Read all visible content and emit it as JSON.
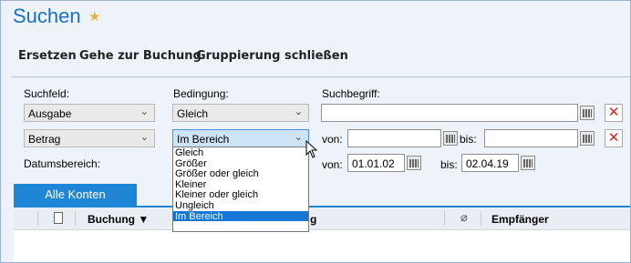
{
  "window": {
    "title": "Suchen"
  },
  "menu": {
    "items": [
      "Ersetzen",
      "Gehe zur Buchung",
      "Gruppierung schließen"
    ]
  },
  "labels": {
    "suchfeld": "Suchfeld:",
    "bedingung": "Bedingung:",
    "suchbegriff": "Suchbegriff:",
    "von": "von:",
    "bis": "bis:",
    "datumsbereich": "Datumsbereich:"
  },
  "row1": {
    "field": "Ausgabe",
    "condition": "Gleich",
    "term": ""
  },
  "row2": {
    "field": "Betrag",
    "condition": "Im Bereich",
    "from": "",
    "to": ""
  },
  "date": {
    "from": "01.01.02",
    "to": "02.04.19"
  },
  "tabs": {
    "active": "Alle Konten"
  },
  "grid": {
    "columns": [
      "Buchung",
      "g",
      "Empfänger"
    ],
    "sort_indicator": "▼"
  },
  "dropdown": {
    "options": [
      "Gleich",
      "Größer",
      "Größer oder gleich",
      "Kleiner",
      "Kleiner oder gleich",
      "Ungleich",
      "Im Bereich"
    ],
    "selected": "Im Bereich"
  },
  "colors": {
    "accent": "#1f86d6",
    "title": "#1a6fc9",
    "delete": "#d22222"
  }
}
